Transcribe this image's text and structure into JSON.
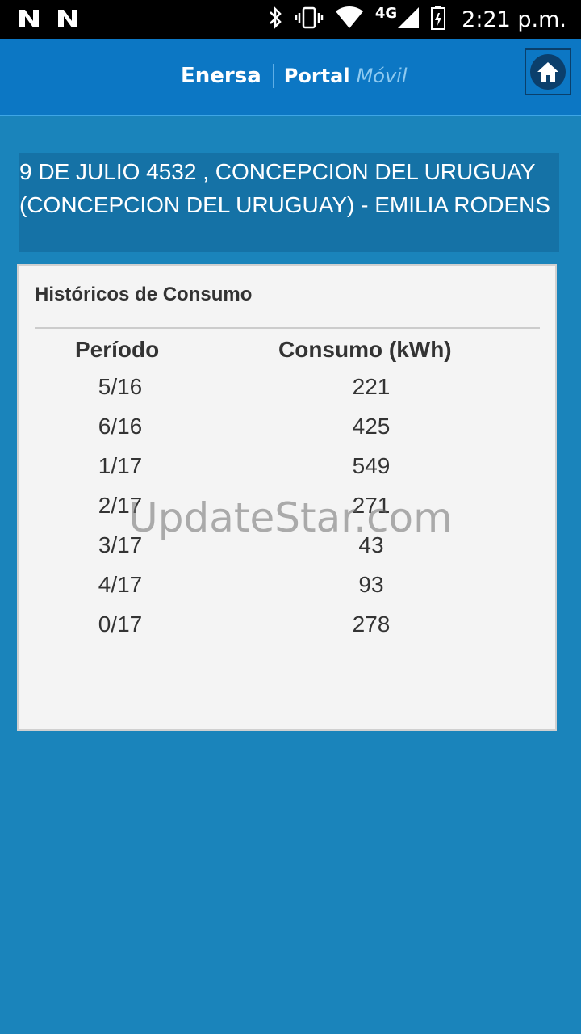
{
  "status_bar": {
    "time": "2:21 p.m.",
    "network": "4G",
    "icons": [
      "n-notification-icon",
      "n-notification-icon",
      "bluetooth-icon",
      "vibrate-icon",
      "wifi-icon",
      "signal-icon",
      "battery-icon"
    ]
  },
  "header": {
    "brand": "Enersa",
    "portal": "Portal",
    "movil": "Móvil",
    "home_icon": "home-icon"
  },
  "address": {
    "text": "9 DE JULIO 4532 , CONCEPCION DEL URUGUAY (CONCEPCION DEL URUGUAY) - EMILIA RODENS"
  },
  "consumption": {
    "title": "Históricos de Consumo",
    "columns": {
      "period": "Período",
      "consumo": "Consumo (kWh)"
    },
    "rows": [
      {
        "period": "5/16",
        "kwh": "221"
      },
      {
        "period": "6/16",
        "kwh": "425"
      },
      {
        "period": "1/17",
        "kwh": "549"
      },
      {
        "period": "2/17",
        "kwh": "271"
      },
      {
        "period": "3/17",
        "kwh": "43"
      },
      {
        "period": "4/17",
        "kwh": "93"
      },
      {
        "period": "0/17",
        "kwh": "278"
      }
    ]
  },
  "watermark": "UpdateStar.com",
  "colors": {
    "background": "#1a84bb",
    "header": "#0c77c4",
    "address_bg": "#1572a6",
    "card_bg": "#f4f4f4"
  }
}
